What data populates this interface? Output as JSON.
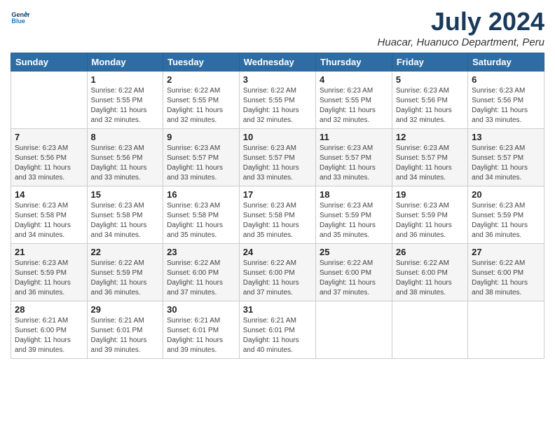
{
  "logo": {
    "line1": "General",
    "line2": "Blue"
  },
  "title": "July 2024",
  "subtitle": "Huacar, Huanuco Department, Peru",
  "days_header": [
    "Sunday",
    "Monday",
    "Tuesday",
    "Wednesday",
    "Thursday",
    "Friday",
    "Saturday"
  ],
  "weeks": [
    [
      {
        "day": "",
        "info": ""
      },
      {
        "day": "1",
        "info": "Sunrise: 6:22 AM\nSunset: 5:55 PM\nDaylight: 11 hours\nand 32 minutes."
      },
      {
        "day": "2",
        "info": "Sunrise: 6:22 AM\nSunset: 5:55 PM\nDaylight: 11 hours\nand 32 minutes."
      },
      {
        "day": "3",
        "info": "Sunrise: 6:22 AM\nSunset: 5:55 PM\nDaylight: 11 hours\nand 32 minutes."
      },
      {
        "day": "4",
        "info": "Sunrise: 6:23 AM\nSunset: 5:55 PM\nDaylight: 11 hours\nand 32 minutes."
      },
      {
        "day": "5",
        "info": "Sunrise: 6:23 AM\nSunset: 5:56 PM\nDaylight: 11 hours\nand 32 minutes."
      },
      {
        "day": "6",
        "info": "Sunrise: 6:23 AM\nSunset: 5:56 PM\nDaylight: 11 hours\nand 33 minutes."
      }
    ],
    [
      {
        "day": "7",
        "info": "Sunrise: 6:23 AM\nSunset: 5:56 PM\nDaylight: 11 hours\nand 33 minutes."
      },
      {
        "day": "8",
        "info": "Sunrise: 6:23 AM\nSunset: 5:56 PM\nDaylight: 11 hours\nand 33 minutes."
      },
      {
        "day": "9",
        "info": "Sunrise: 6:23 AM\nSunset: 5:57 PM\nDaylight: 11 hours\nand 33 minutes."
      },
      {
        "day": "10",
        "info": "Sunrise: 6:23 AM\nSunset: 5:57 PM\nDaylight: 11 hours\nand 33 minutes."
      },
      {
        "day": "11",
        "info": "Sunrise: 6:23 AM\nSunset: 5:57 PM\nDaylight: 11 hours\nand 33 minutes."
      },
      {
        "day": "12",
        "info": "Sunrise: 6:23 AM\nSunset: 5:57 PM\nDaylight: 11 hours\nand 34 minutes."
      },
      {
        "day": "13",
        "info": "Sunrise: 6:23 AM\nSunset: 5:57 PM\nDaylight: 11 hours\nand 34 minutes."
      }
    ],
    [
      {
        "day": "14",
        "info": "Sunrise: 6:23 AM\nSunset: 5:58 PM\nDaylight: 11 hours\nand 34 minutes."
      },
      {
        "day": "15",
        "info": "Sunrise: 6:23 AM\nSunset: 5:58 PM\nDaylight: 11 hours\nand 34 minutes."
      },
      {
        "day": "16",
        "info": "Sunrise: 6:23 AM\nSunset: 5:58 PM\nDaylight: 11 hours\nand 35 minutes."
      },
      {
        "day": "17",
        "info": "Sunrise: 6:23 AM\nSunset: 5:58 PM\nDaylight: 11 hours\nand 35 minutes."
      },
      {
        "day": "18",
        "info": "Sunrise: 6:23 AM\nSunset: 5:59 PM\nDaylight: 11 hours\nand 35 minutes."
      },
      {
        "day": "19",
        "info": "Sunrise: 6:23 AM\nSunset: 5:59 PM\nDaylight: 11 hours\nand 36 minutes."
      },
      {
        "day": "20",
        "info": "Sunrise: 6:23 AM\nSunset: 5:59 PM\nDaylight: 11 hours\nand 36 minutes."
      }
    ],
    [
      {
        "day": "21",
        "info": "Sunrise: 6:23 AM\nSunset: 5:59 PM\nDaylight: 11 hours\nand 36 minutes."
      },
      {
        "day": "22",
        "info": "Sunrise: 6:22 AM\nSunset: 5:59 PM\nDaylight: 11 hours\nand 36 minutes."
      },
      {
        "day": "23",
        "info": "Sunrise: 6:22 AM\nSunset: 6:00 PM\nDaylight: 11 hours\nand 37 minutes."
      },
      {
        "day": "24",
        "info": "Sunrise: 6:22 AM\nSunset: 6:00 PM\nDaylight: 11 hours\nand 37 minutes."
      },
      {
        "day": "25",
        "info": "Sunrise: 6:22 AM\nSunset: 6:00 PM\nDaylight: 11 hours\nand 37 minutes."
      },
      {
        "day": "26",
        "info": "Sunrise: 6:22 AM\nSunset: 6:00 PM\nDaylight: 11 hours\nand 38 minutes."
      },
      {
        "day": "27",
        "info": "Sunrise: 6:22 AM\nSunset: 6:00 PM\nDaylight: 11 hours\nand 38 minutes."
      }
    ],
    [
      {
        "day": "28",
        "info": "Sunrise: 6:21 AM\nSunset: 6:00 PM\nDaylight: 11 hours\nand 39 minutes."
      },
      {
        "day": "29",
        "info": "Sunrise: 6:21 AM\nSunset: 6:01 PM\nDaylight: 11 hours\nand 39 minutes."
      },
      {
        "day": "30",
        "info": "Sunrise: 6:21 AM\nSunset: 6:01 PM\nDaylight: 11 hours\nand 39 minutes."
      },
      {
        "day": "31",
        "info": "Sunrise: 6:21 AM\nSunset: 6:01 PM\nDaylight: 11 hours\nand 40 minutes."
      },
      {
        "day": "",
        "info": ""
      },
      {
        "day": "",
        "info": ""
      },
      {
        "day": "",
        "info": ""
      }
    ]
  ]
}
